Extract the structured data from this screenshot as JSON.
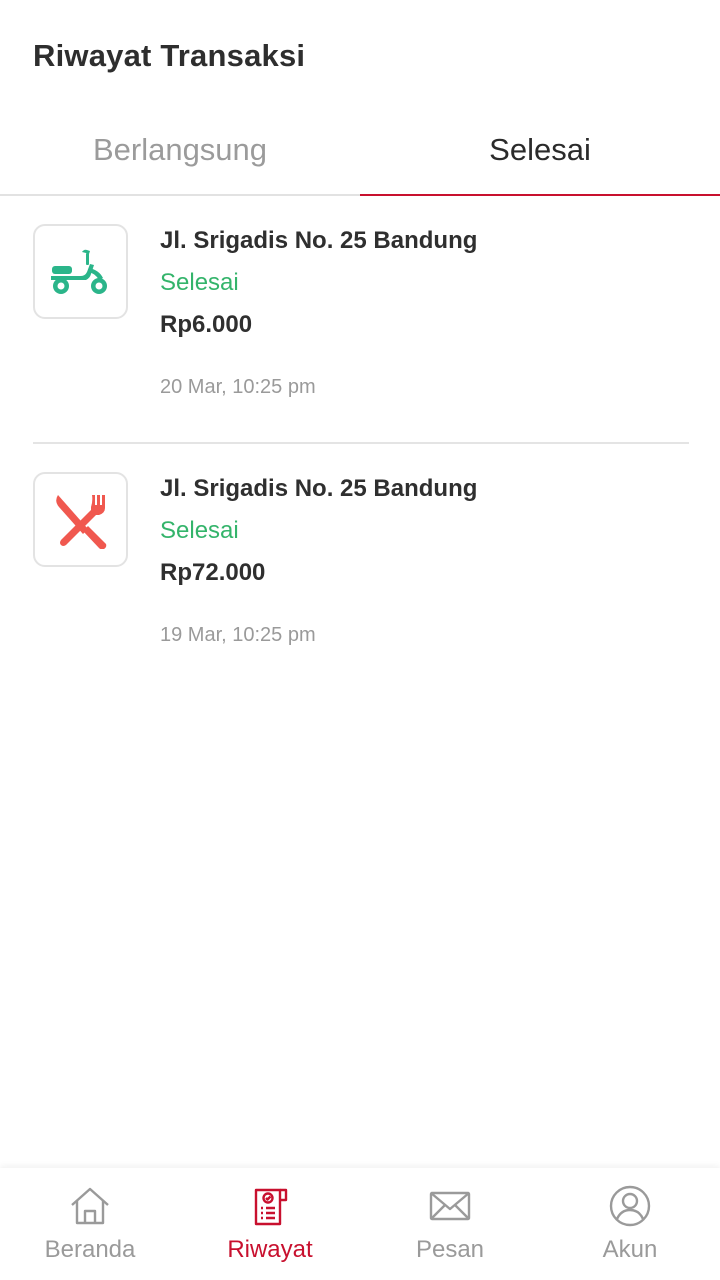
{
  "header": {
    "title": "Riwayat Transaksi"
  },
  "tabs": [
    {
      "label": "Berlangsung",
      "active": false
    },
    {
      "label": "Selesai",
      "active": true
    }
  ],
  "transactions": [
    {
      "icon": "scooter-icon",
      "address": "Jl. Srigadis No. 25 Bandung",
      "status": "Selesai",
      "price": "Rp6.000",
      "time": "20 Mar, 10:25 pm"
    },
    {
      "icon": "food-utensils-icon",
      "address": "Jl. Srigadis No. 25 Bandung",
      "status": "Selesai",
      "price": "Rp72.000",
      "time": "19 Mar, 10:25 pm"
    }
  ],
  "bottom_nav": [
    {
      "label": "Beranda",
      "icon": "home-icon",
      "active": false
    },
    {
      "label": "Riwayat",
      "icon": "history-icon",
      "active": true
    },
    {
      "label": "Pesan",
      "icon": "mail-icon",
      "active": false
    },
    {
      "label": "Akun",
      "icon": "account-icon",
      "active": false
    }
  ],
  "colors": {
    "accent": "#c8102e",
    "status_done": "#34b46b",
    "scooter_icon": "#2bb58a",
    "food_icon": "#f0584f"
  }
}
